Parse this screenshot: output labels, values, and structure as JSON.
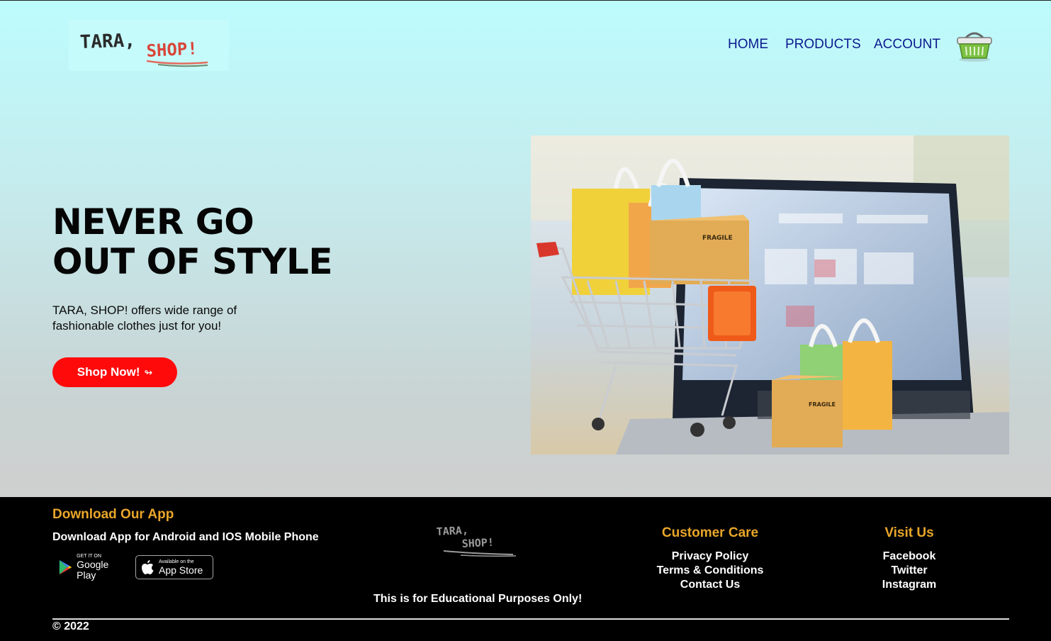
{
  "header": {
    "logo_text": "TARA, SHOP!",
    "nav": [
      {
        "label": "HOME"
      },
      {
        "label": "PRODUCTS"
      },
      {
        "label": "ACCOUNT"
      }
    ],
    "cart_icon": "shopping-basket-icon"
  },
  "hero": {
    "headline_line1": "NEVER GO",
    "headline_line2": "OUT OF STYLE",
    "tagline": "TARA, SHOP! offers wide range of fashionable clothes just for you!",
    "cta_label": "Shop Now!",
    "cta_icon": "↬"
  },
  "footer": {
    "app": {
      "title": "Download Our App",
      "subtitle": "Download App for Android and IOS Mobile Phone",
      "google_play": {
        "small": "GET IT ON",
        "big": "Google Play"
      },
      "app_store": {
        "small": "Available on the",
        "big": "App Store"
      }
    },
    "logo_text": "TARA, SHOP!",
    "disclaimer": "This is for Educational Purposes Only!",
    "customer_care": {
      "title": "Customer Care",
      "links": [
        "Privacy Policy",
        "Terms & Conditions",
        "Contact Us"
      ]
    },
    "visit_us": {
      "title": "Visit Us",
      "links": [
        "Facebook",
        "Twitter",
        "Instagram"
      ]
    },
    "copyright": "© 2022"
  },
  "colors": {
    "nav_text": "#0b1a8f",
    "cta_bg": "#ff0a0a",
    "footer_heading": "#e9a62a",
    "footer_bg": "#000000"
  }
}
